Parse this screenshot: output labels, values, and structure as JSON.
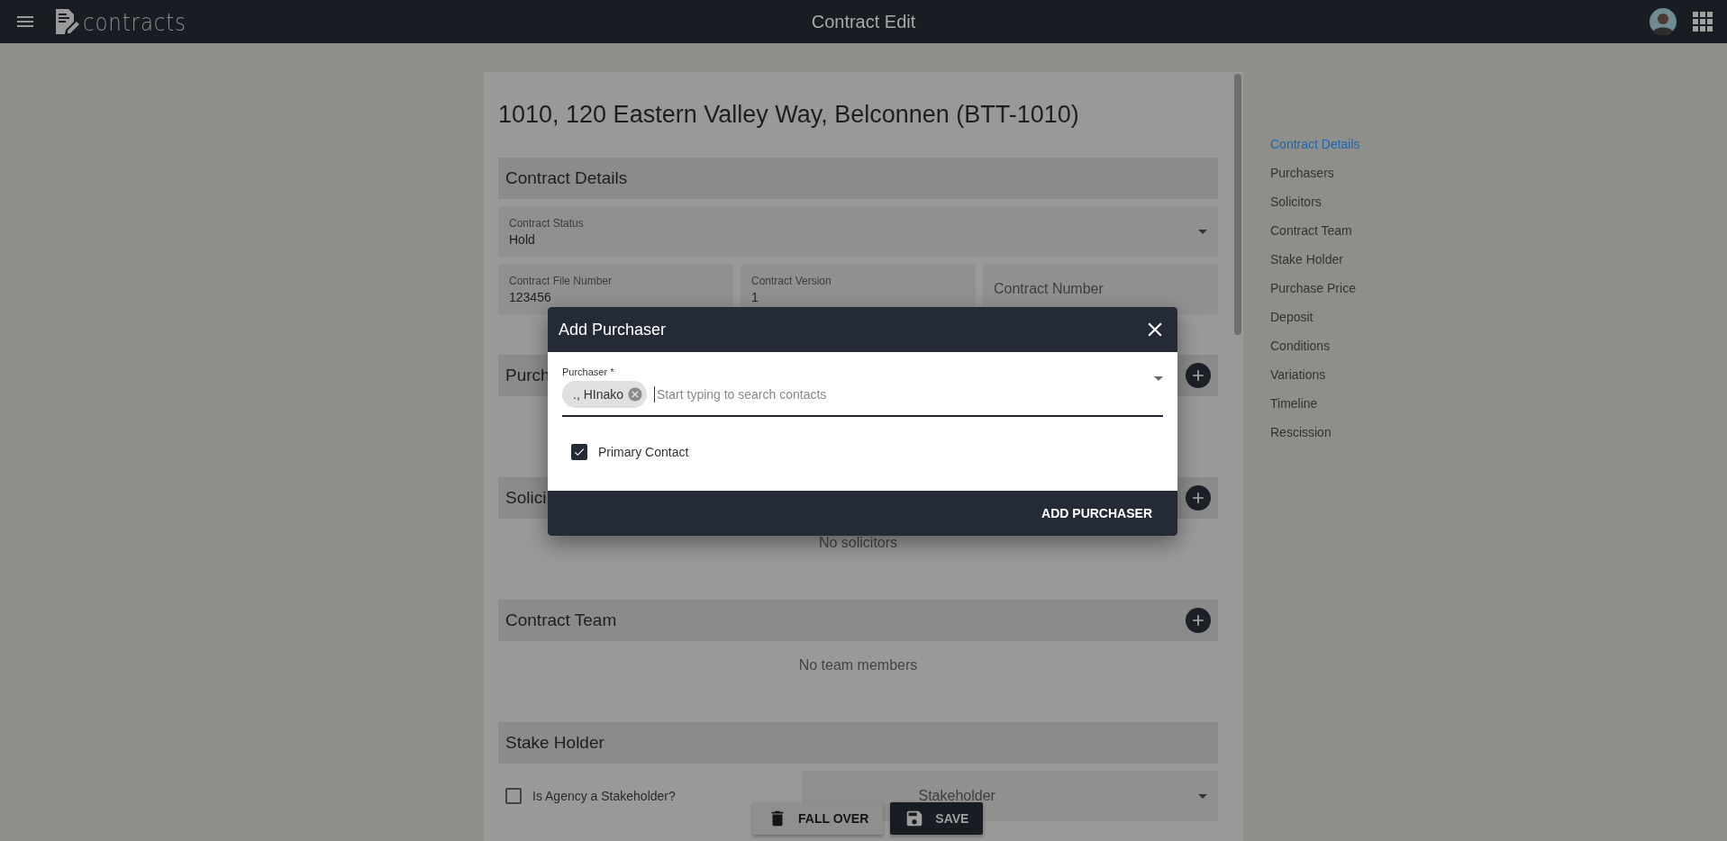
{
  "app_bar": {
    "logo": "contracts",
    "title": "Contract Edit"
  },
  "contract": {
    "title": "1010, 120 Eastern Valley Way, Belconnen (BTT-1010)",
    "details": {
      "heading": "Contract Details",
      "status": {
        "label": "Contract Status",
        "value": "Hold"
      },
      "fields": [
        {
          "label": "Contract File Number",
          "value": "123456"
        },
        {
          "label": "Contract Version",
          "value": "1"
        },
        {
          "placeholder": "Contract Number"
        }
      ]
    },
    "sections": [
      {
        "heading": "Purch"
      },
      {
        "heading": "Solici",
        "empty_text": "No solicitors"
      },
      {
        "heading": "Contract Team",
        "empty_text": "No team members"
      }
    ],
    "stake_holder": {
      "heading": "Stake Holder",
      "checkbox": {
        "label": "Is Agency a Stakeholder?",
        "checked": false
      },
      "select": {
        "placeholder": "Stakeholder"
      }
    }
  },
  "nav": [
    {
      "label": "Contract Details",
      "selected": true
    },
    {
      "label": "Purchasers",
      "selected": false
    },
    {
      "label": "Solicitors",
      "selected": false
    },
    {
      "label": "Contract Team",
      "selected": false
    },
    {
      "label": "Stake Holder",
      "selected": false
    },
    {
      "label": "Purchase Price",
      "selected": false
    },
    {
      "label": "Deposit",
      "selected": false
    },
    {
      "label": "Conditions",
      "selected": false
    },
    {
      "label": "Variations",
      "selected": false
    },
    {
      "label": "Timeline",
      "selected": false
    },
    {
      "label": "Rescission",
      "selected": false
    }
  ],
  "actions": [
    {
      "kind": "delete",
      "label": "FALL OVER"
    },
    {
      "kind": "save",
      "label": "SAVE"
    }
  ],
  "dialog": {
    "title": "Add Purchaser",
    "field": {
      "label": "Purchaser *",
      "chips": [
        "., HInako"
      ],
      "placeholder": "Start typing to search contacts"
    },
    "checkbox": {
      "label": "Primary Contact",
      "checked": true
    },
    "button": "ADD PURCHASER"
  }
}
